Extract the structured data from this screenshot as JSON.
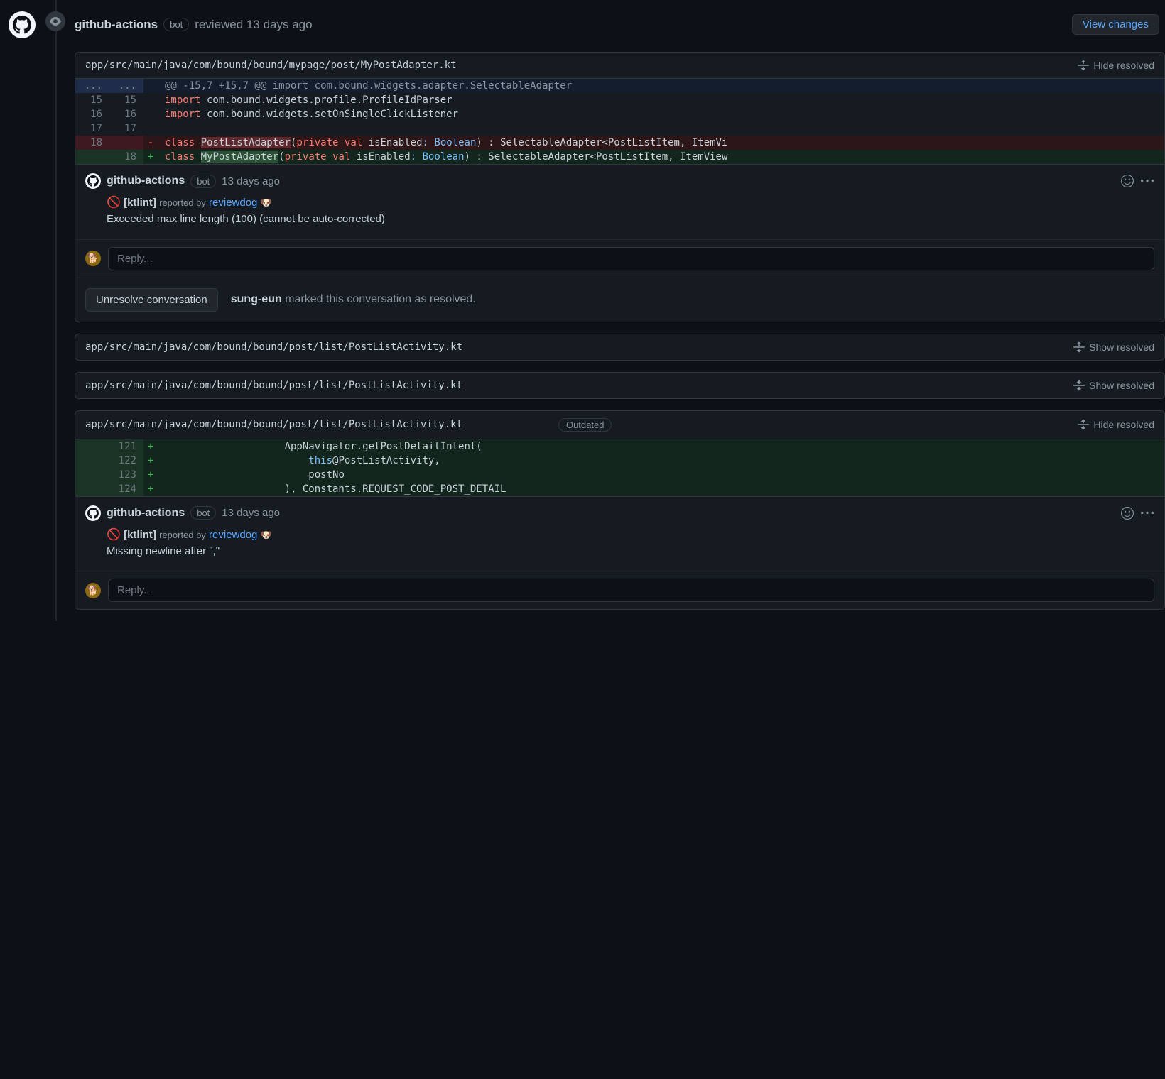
{
  "header": {
    "author": "github-actions",
    "bot_label": "bot",
    "action": "reviewed 13 days ago",
    "view_changes": "View changes"
  },
  "cards": [
    {
      "file_path": "app/src/main/java/com/bound/bound/mypage/post/MyPostAdapter.kt",
      "toggle": "Hide resolved",
      "hunk": "@@ -15,7 +15,7 @@ import com.bound.widgets.adapter.SelectableAdapter",
      "rows": [
        {
          "old": "15",
          "new": "15",
          "code": "import com.bound.widgets.profile.ProfileIdParser"
        },
        {
          "old": "16",
          "new": "16",
          "code": "import com.bound.widgets.setOnSingleClickListener"
        },
        {
          "old": "17",
          "new": "17",
          "code": ""
        },
        {
          "old": "18",
          "type": "del",
          "name_old": "PostListAdapter",
          "tail": "(private val isEnabled: Boolean) : SelectableAdapter<PostListItem, ItemVi"
        },
        {
          "new": "18",
          "type": "add",
          "name_new": "MyPostAdapter",
          "tail": "(private val isEnabled: Boolean) : SelectableAdapter<PostListItem, ItemView"
        }
      ],
      "comment": {
        "author": "github-actions",
        "bot": "bot",
        "time": "13 days ago",
        "tag": "[ktlint]",
        "reported_by": "reported by",
        "reviewdog": "reviewdog",
        "dog": "🐶",
        "message": "Exceeded max line length (100) (cannot be auto-corrected)"
      },
      "reply_placeholder": "Reply...",
      "unresolve": "Unresolve conversation",
      "resolved_user": "sung-eun",
      "resolved_text": "marked this conversation as resolved."
    }
  ],
  "collapsed": [
    {
      "file_path": "app/src/main/java/com/bound/bound/post/list/PostListActivity.kt",
      "toggle": "Show resolved"
    },
    {
      "file_path": "app/src/main/java/com/bound/bound/post/list/PostListActivity.kt",
      "toggle": "Show resolved"
    }
  ],
  "card2": {
    "file_path": "app/src/main/java/com/bound/bound/post/list/PostListActivity.kt",
    "outdated": "Outdated",
    "toggle": "Hide resolved",
    "rows": [
      {
        "new": "121",
        "indent": "                    ",
        "l1a": "AppNavigator",
        "l1b": ".getPostDetailIntent("
      },
      {
        "new": "122",
        "indent": "                        ",
        "l2a": "this",
        "l2b": "@PostListActivity,"
      },
      {
        "new": "123",
        "indent": "                        ",
        "l3": "postNo"
      },
      {
        "new": "124",
        "indent": "                    ",
        "l4": "), Constants.REQUEST_CODE_POST_DETAIL"
      }
    ],
    "comment": {
      "author": "github-actions",
      "bot": "bot",
      "time": "13 days ago",
      "tag": "[ktlint]",
      "reported_by": "reported by",
      "reviewdog": "reviewdog",
      "dog": "🐶",
      "message": "Missing newline after \",\""
    },
    "reply_placeholder": "Reply..."
  }
}
